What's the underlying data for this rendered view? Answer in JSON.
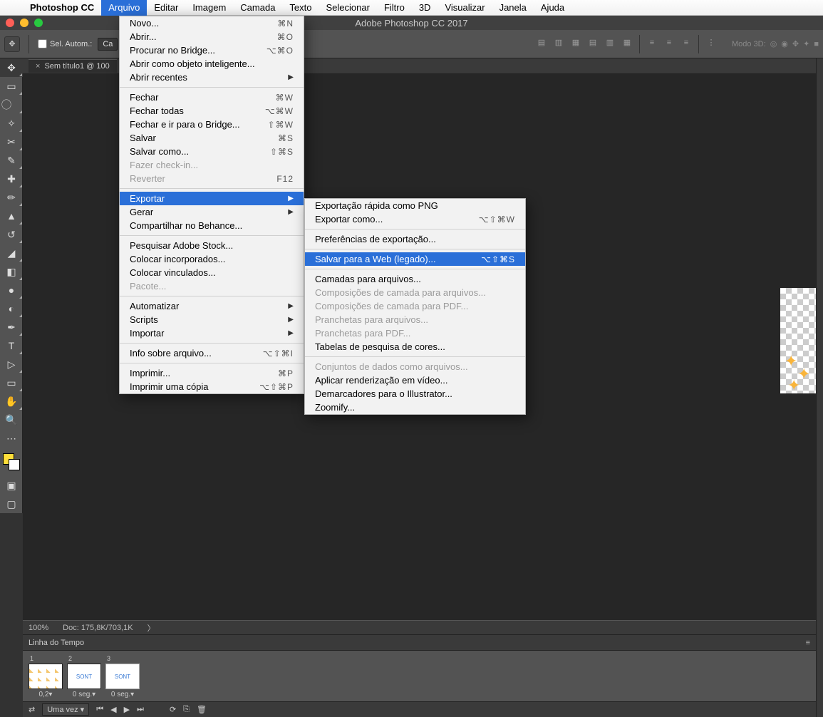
{
  "menubar": {
    "app": "Photoshop CC",
    "items": [
      "Arquivo",
      "Editar",
      "Imagem",
      "Camada",
      "Texto",
      "Selecionar",
      "Filtro",
      "3D",
      "Visualizar",
      "Janela",
      "Ajuda"
    ],
    "active_index": 0
  },
  "window_title": "Adobe Photoshop CC 2017",
  "options_bar": {
    "autoselect_label": "Sel. Autom.:",
    "autoselect_value": "Ca",
    "mode3d_label": "Modo 3D:"
  },
  "doc_tab": "Sem título1 @ 100",
  "status": {
    "zoom": "100%",
    "doc": "Doc: 175,8K/703,1K"
  },
  "timeline": {
    "title": "Linha do Tempo",
    "loop": "Uma vez",
    "frames": [
      {
        "n": "1",
        "dur": "0,2▾"
      },
      {
        "n": "2",
        "dur": "0 seg.▾"
      },
      {
        "n": "3",
        "dur": "0 seg.▾"
      }
    ]
  },
  "arquivo_menu": [
    {
      "label": "Novo...",
      "sc": "⌘N"
    },
    {
      "label": "Abrir...",
      "sc": "⌘O"
    },
    {
      "label": "Procurar no Bridge...",
      "sc": "⌥⌘O"
    },
    {
      "label": "Abrir como objeto inteligente..."
    },
    {
      "label": "Abrir recentes",
      "submenu": true
    },
    {
      "sep": true
    },
    {
      "label": "Fechar",
      "sc": "⌘W"
    },
    {
      "label": "Fechar todas",
      "sc": "⌥⌘W"
    },
    {
      "label": "Fechar e ir para o Bridge...",
      "sc": "⇧⌘W"
    },
    {
      "label": "Salvar",
      "sc": "⌘S"
    },
    {
      "label": "Salvar como...",
      "sc": "⇧⌘S"
    },
    {
      "label": "Fazer check-in...",
      "disabled": true
    },
    {
      "label": "Reverter",
      "sc": "F12",
      "disabled": true
    },
    {
      "sep": true
    },
    {
      "label": "Exportar",
      "submenu": true,
      "hover": true
    },
    {
      "label": "Gerar",
      "submenu": true
    },
    {
      "label": "Compartilhar no Behance..."
    },
    {
      "sep": true
    },
    {
      "label": "Pesquisar Adobe Stock..."
    },
    {
      "label": "Colocar incorporados..."
    },
    {
      "label": "Colocar vinculados..."
    },
    {
      "label": "Pacote...",
      "disabled": true
    },
    {
      "sep": true
    },
    {
      "label": "Automatizar",
      "submenu": true
    },
    {
      "label": "Scripts",
      "submenu": true
    },
    {
      "label": "Importar",
      "submenu": true
    },
    {
      "sep": true
    },
    {
      "label": "Info sobre arquivo...",
      "sc": "⌥⇧⌘I"
    },
    {
      "sep": true
    },
    {
      "label": "Imprimir...",
      "sc": "⌘P"
    },
    {
      "label": "Imprimir uma cópia",
      "sc": "⌥⇧⌘P"
    }
  ],
  "exportar_menu": [
    {
      "label": "Exportação rápida como PNG"
    },
    {
      "label": "Exportar como...",
      "sc": "⌥⇧⌘W"
    },
    {
      "sep": true
    },
    {
      "label": "Preferências de exportação..."
    },
    {
      "sep": true
    },
    {
      "label": "Salvar para a Web (legado)...",
      "sc": "⌥⇧⌘S",
      "hover": true
    },
    {
      "sep": true
    },
    {
      "label": "Camadas para arquivos..."
    },
    {
      "label": "Composições de camada para arquivos...",
      "disabled": true
    },
    {
      "label": "Composições de camada para PDF...",
      "disabled": true
    },
    {
      "label": "Pranchetas para arquivos...",
      "disabled": true
    },
    {
      "label": "Pranchetas para PDF...",
      "disabled": true
    },
    {
      "label": "Tabelas de pesquisa de cores..."
    },
    {
      "sep": true
    },
    {
      "label": "Conjuntos de dados como arquivos...",
      "disabled": true
    },
    {
      "label": "Aplicar renderização em vídeo..."
    },
    {
      "label": "Demarcadores para o Illustrator..."
    },
    {
      "label": "Zoomify..."
    }
  ]
}
